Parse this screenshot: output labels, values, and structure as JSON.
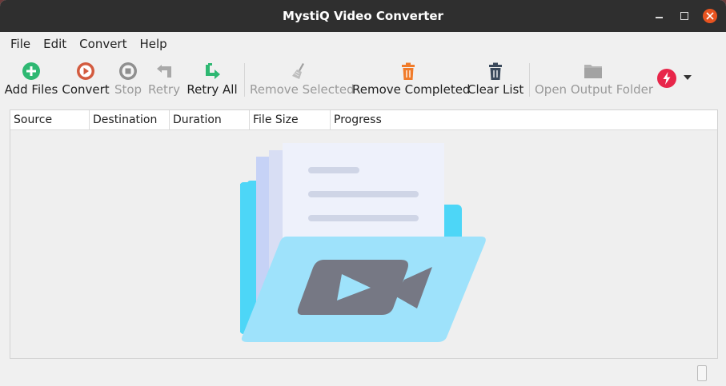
{
  "window": {
    "title": "MystiQ Video Converter"
  },
  "menu": [
    {
      "label": "File"
    },
    {
      "label": "Edit"
    },
    {
      "label": "Convert"
    },
    {
      "label": "Help"
    }
  ],
  "toolbar": {
    "add_files": "Add Files",
    "convert": "Convert",
    "stop": "Stop",
    "retry": "Retry",
    "retry_all": "Retry All",
    "remove_selected": "Remove Selected",
    "remove_completed": "Remove Completed",
    "clear_list": "Clear List",
    "open_output_folder": "Open Output Folder"
  },
  "table": {
    "columns": [
      "Source",
      "Destination",
      "Duration",
      "File Size",
      "Progress"
    ]
  },
  "colors": {
    "accent_green": "#2eb872",
    "convert_red": "#d35b3f",
    "remove_orange": "#f07b2a",
    "power_red": "#e8264a",
    "folder_cyan": "#4dd6f7",
    "folder_front": "#9ee2fb"
  }
}
